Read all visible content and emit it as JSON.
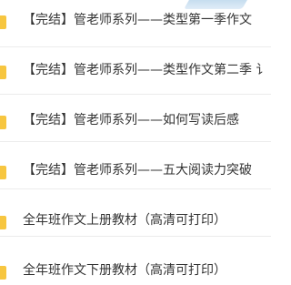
{
  "file_list": {
    "items": [
      {
        "label": "【完结】管老师系列——类型第一季作文",
        "icon": "folder-icon"
      },
      {
        "label": "【完结】管老师系列——类型作文第二季 讠",
        "icon": "folder-icon"
      },
      {
        "label": "【完结】管老师系列——如何写读后感",
        "icon": "folder-icon"
      },
      {
        "label": "【完结】管老师系列——五大阅读力突破",
        "icon": "folder-icon"
      },
      {
        "label": "全年班作文上册教材（高清可打印）",
        "icon": "folder-icon"
      },
      {
        "label": "全年班作文下册教材（高清可打印）",
        "icon": "folder-icon"
      }
    ]
  },
  "colors": {
    "folder": "#f7c640",
    "text": "#333333",
    "divider": "#ececec"
  }
}
